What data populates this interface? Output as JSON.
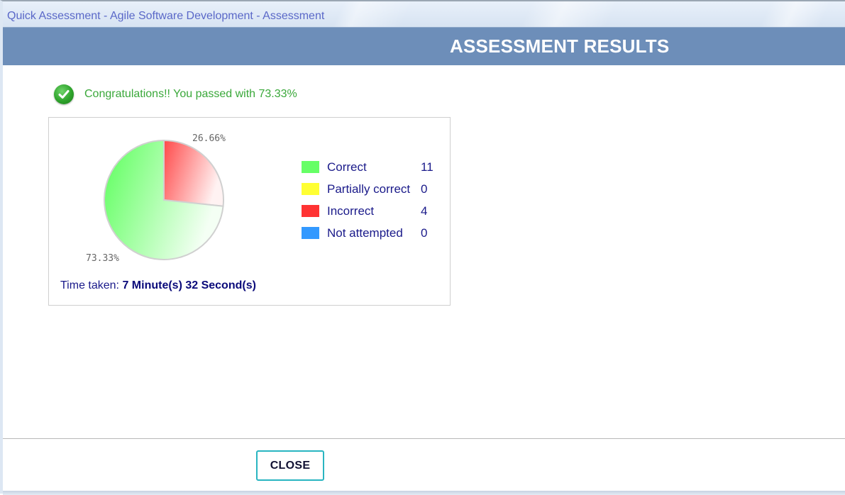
{
  "window": {
    "title": "Quick Assessment - Agile Software Development - Assessment"
  },
  "header": {
    "title": "ASSESSMENT RESULTS"
  },
  "result": {
    "message": "Congratulations!! You passed with 73.33%",
    "icon": "check-circle-icon",
    "color": "#3aa83a"
  },
  "chart_data": {
    "type": "pie",
    "categories": [
      "Correct",
      "Incorrect"
    ],
    "values": [
      73.33,
      26.66
    ],
    "slice_labels": [
      "73.33%",
      "26.66%"
    ],
    "colors": [
      "#66ff66",
      "#ff4444"
    ]
  },
  "legend": {
    "items": [
      {
        "label": "Correct",
        "value": "11",
        "color": "#66ff66"
      },
      {
        "label": "Partially correct",
        "value": "0",
        "color": "#ffff33"
      },
      {
        "label": "Incorrect",
        "value": "4",
        "color": "#ff3333"
      },
      {
        "label": "Not attempted",
        "value": "0",
        "color": "#3399ff"
      }
    ]
  },
  "time_taken": {
    "label": "Time taken:",
    "value": "7 Minute(s) 32 Second(s)"
  },
  "footer": {
    "close_label": "CLOSE"
  }
}
